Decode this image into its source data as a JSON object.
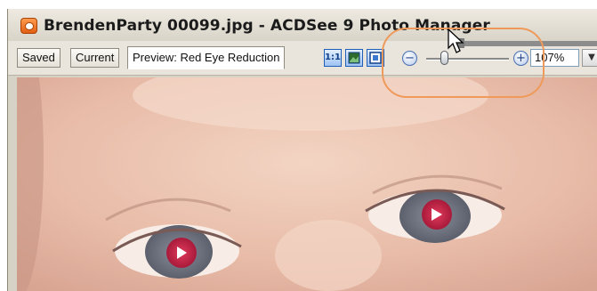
{
  "window": {
    "title": "BrendenParty 00099.jpg - ACDSee 9 Photo Manager"
  },
  "tabs": [
    {
      "label": "Saved",
      "active": false
    },
    {
      "label": "Current",
      "active": false
    },
    {
      "label": "Preview: Red Eye Reduction",
      "active": true
    }
  ],
  "view_buttons": [
    {
      "label": "1:1",
      "icon": "actual-size-icon"
    },
    {
      "label": "",
      "icon": "fit-image-icon"
    },
    {
      "label": "",
      "icon": "fit-width-icon"
    }
  ],
  "zoom": {
    "minus_label": "−",
    "plus_label": "+",
    "value": "107%",
    "slider_fraction": 0.2
  },
  "colors": {
    "highlight": "#ef9a5a",
    "button_border": "#1f5fb8",
    "red_eye": "#c8264a"
  },
  "photo": {
    "description_icon": "baby-face-photo",
    "red_eye_markers": 2
  }
}
